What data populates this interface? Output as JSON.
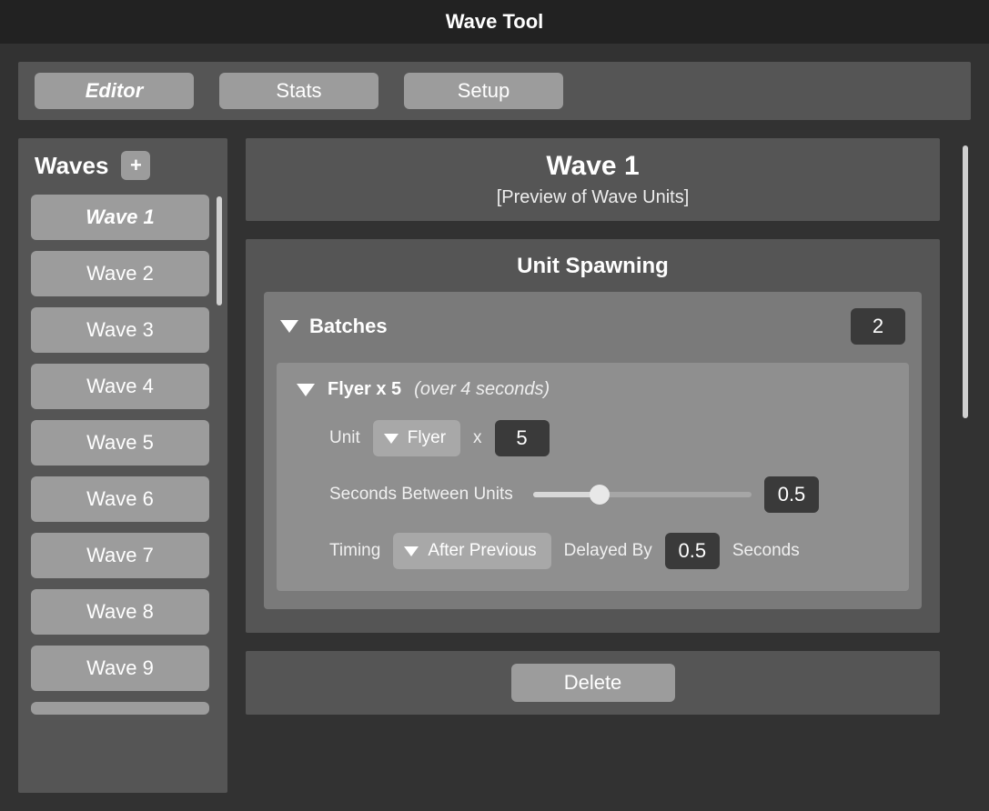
{
  "app": {
    "title": "Wave Tool"
  },
  "tabs": {
    "editor": "Editor",
    "stats": "Stats",
    "setup": "Setup",
    "active": "editor"
  },
  "sidebar": {
    "title": "Waves",
    "add_label": "+",
    "items": [
      {
        "label": "Wave 1",
        "active": true
      },
      {
        "label": "Wave 2",
        "active": false
      },
      {
        "label": "Wave 3",
        "active": false
      },
      {
        "label": "Wave 4",
        "active": false
      },
      {
        "label": "Wave 5",
        "active": false
      },
      {
        "label": "Wave 6",
        "active": false
      },
      {
        "label": "Wave 7",
        "active": false
      },
      {
        "label": "Wave 8",
        "active": false
      },
      {
        "label": "Wave 9",
        "active": false
      }
    ]
  },
  "header": {
    "title": "Wave 1",
    "subtitle": "[Preview of Wave Units]"
  },
  "spawning": {
    "title": "Unit Spawning",
    "batches_label": "Batches",
    "batches_count": "2",
    "batch": {
      "summary_bold": "Flyer x 5",
      "summary_italic": "(over 4 seconds)",
      "unit_label": "Unit",
      "unit_value": "Flyer",
      "multiply_label": "x",
      "count_value": "5",
      "seconds_between_label": "Seconds Between Units",
      "seconds_between_value": "0.5",
      "timing_label": "Timing",
      "timing_value": "After Previous",
      "delayed_by_label": "Delayed By",
      "delayed_by_value": "0.5",
      "seconds_label": "Seconds"
    }
  },
  "footer": {
    "delete_label": "Delete"
  }
}
